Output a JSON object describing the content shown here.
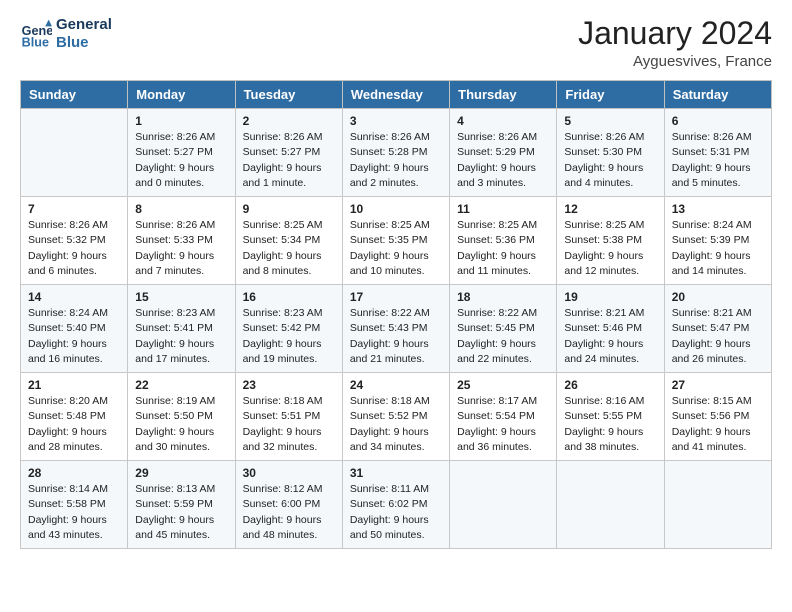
{
  "header": {
    "logo_line1": "General",
    "logo_line2": "Blue",
    "month": "January 2024",
    "location": "Ayguesvives, France"
  },
  "days_of_week": [
    "Sunday",
    "Monday",
    "Tuesday",
    "Wednesday",
    "Thursday",
    "Friday",
    "Saturday"
  ],
  "weeks": [
    [
      {
        "day": "",
        "info": ""
      },
      {
        "day": "1",
        "info": "Sunrise: 8:26 AM\nSunset: 5:27 PM\nDaylight: 9 hours\nand 0 minutes."
      },
      {
        "day": "2",
        "info": "Sunrise: 8:26 AM\nSunset: 5:27 PM\nDaylight: 9 hours\nand 1 minute."
      },
      {
        "day": "3",
        "info": "Sunrise: 8:26 AM\nSunset: 5:28 PM\nDaylight: 9 hours\nand 2 minutes."
      },
      {
        "day": "4",
        "info": "Sunrise: 8:26 AM\nSunset: 5:29 PM\nDaylight: 9 hours\nand 3 minutes."
      },
      {
        "day": "5",
        "info": "Sunrise: 8:26 AM\nSunset: 5:30 PM\nDaylight: 9 hours\nand 4 minutes."
      },
      {
        "day": "6",
        "info": "Sunrise: 8:26 AM\nSunset: 5:31 PM\nDaylight: 9 hours\nand 5 minutes."
      }
    ],
    [
      {
        "day": "7",
        "info": "Sunrise: 8:26 AM\nSunset: 5:32 PM\nDaylight: 9 hours\nand 6 minutes."
      },
      {
        "day": "8",
        "info": "Sunrise: 8:26 AM\nSunset: 5:33 PM\nDaylight: 9 hours\nand 7 minutes."
      },
      {
        "day": "9",
        "info": "Sunrise: 8:25 AM\nSunset: 5:34 PM\nDaylight: 9 hours\nand 8 minutes."
      },
      {
        "day": "10",
        "info": "Sunrise: 8:25 AM\nSunset: 5:35 PM\nDaylight: 9 hours\nand 10 minutes."
      },
      {
        "day": "11",
        "info": "Sunrise: 8:25 AM\nSunset: 5:36 PM\nDaylight: 9 hours\nand 11 minutes."
      },
      {
        "day": "12",
        "info": "Sunrise: 8:25 AM\nSunset: 5:38 PM\nDaylight: 9 hours\nand 12 minutes."
      },
      {
        "day": "13",
        "info": "Sunrise: 8:24 AM\nSunset: 5:39 PM\nDaylight: 9 hours\nand 14 minutes."
      }
    ],
    [
      {
        "day": "14",
        "info": "Sunrise: 8:24 AM\nSunset: 5:40 PM\nDaylight: 9 hours\nand 16 minutes."
      },
      {
        "day": "15",
        "info": "Sunrise: 8:23 AM\nSunset: 5:41 PM\nDaylight: 9 hours\nand 17 minutes."
      },
      {
        "day": "16",
        "info": "Sunrise: 8:23 AM\nSunset: 5:42 PM\nDaylight: 9 hours\nand 19 minutes."
      },
      {
        "day": "17",
        "info": "Sunrise: 8:22 AM\nSunset: 5:43 PM\nDaylight: 9 hours\nand 21 minutes."
      },
      {
        "day": "18",
        "info": "Sunrise: 8:22 AM\nSunset: 5:45 PM\nDaylight: 9 hours\nand 22 minutes."
      },
      {
        "day": "19",
        "info": "Sunrise: 8:21 AM\nSunset: 5:46 PM\nDaylight: 9 hours\nand 24 minutes."
      },
      {
        "day": "20",
        "info": "Sunrise: 8:21 AM\nSunset: 5:47 PM\nDaylight: 9 hours\nand 26 minutes."
      }
    ],
    [
      {
        "day": "21",
        "info": "Sunrise: 8:20 AM\nSunset: 5:48 PM\nDaylight: 9 hours\nand 28 minutes."
      },
      {
        "day": "22",
        "info": "Sunrise: 8:19 AM\nSunset: 5:50 PM\nDaylight: 9 hours\nand 30 minutes."
      },
      {
        "day": "23",
        "info": "Sunrise: 8:18 AM\nSunset: 5:51 PM\nDaylight: 9 hours\nand 32 minutes."
      },
      {
        "day": "24",
        "info": "Sunrise: 8:18 AM\nSunset: 5:52 PM\nDaylight: 9 hours\nand 34 minutes."
      },
      {
        "day": "25",
        "info": "Sunrise: 8:17 AM\nSunset: 5:54 PM\nDaylight: 9 hours\nand 36 minutes."
      },
      {
        "day": "26",
        "info": "Sunrise: 8:16 AM\nSunset: 5:55 PM\nDaylight: 9 hours\nand 38 minutes."
      },
      {
        "day": "27",
        "info": "Sunrise: 8:15 AM\nSunset: 5:56 PM\nDaylight: 9 hours\nand 41 minutes."
      }
    ],
    [
      {
        "day": "28",
        "info": "Sunrise: 8:14 AM\nSunset: 5:58 PM\nDaylight: 9 hours\nand 43 minutes."
      },
      {
        "day": "29",
        "info": "Sunrise: 8:13 AM\nSunset: 5:59 PM\nDaylight: 9 hours\nand 45 minutes."
      },
      {
        "day": "30",
        "info": "Sunrise: 8:12 AM\nSunset: 6:00 PM\nDaylight: 9 hours\nand 48 minutes."
      },
      {
        "day": "31",
        "info": "Sunrise: 8:11 AM\nSunset: 6:02 PM\nDaylight: 9 hours\nand 50 minutes."
      },
      {
        "day": "",
        "info": ""
      },
      {
        "day": "",
        "info": ""
      },
      {
        "day": "",
        "info": ""
      }
    ]
  ]
}
